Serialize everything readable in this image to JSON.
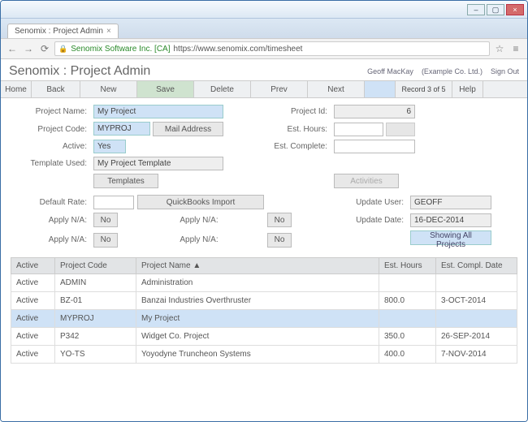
{
  "browser": {
    "tab_title": "Senomix : Project Admin",
    "cert_label": "Senomix Software Inc. [CA]",
    "url": "https://www.senomix.com/timesheet"
  },
  "header": {
    "app_title": "Senomix : Project Admin",
    "user_name": "Geoff MacKay",
    "company": "(Example Co. Ltd.)",
    "signout": "Sign Out"
  },
  "toolbar": {
    "home": "Home",
    "back": "Back",
    "new": "New",
    "save": "Save",
    "delete": "Delete",
    "prev": "Prev",
    "next": "Next",
    "record": "Record 3 of 5",
    "help": "Help"
  },
  "form": {
    "labels": {
      "project_name": "Project Name:",
      "project_code": "Project Code:",
      "active": "Active:",
      "template_used": "Template Used:",
      "project_id": "Project Id:",
      "est_hours": "Est. Hours:",
      "est_complete": "Est. Complete:",
      "default_rate": "Default Rate:",
      "apply_na": "Apply N/A:",
      "update_user": "Update User:",
      "update_date": "Update Date:"
    },
    "values": {
      "project_name": "My Project",
      "project_code": "MYPROJ",
      "active": "Yes",
      "template_used": "My Project Template",
      "project_id": "6",
      "est_hours": "",
      "est_complete": "",
      "default_rate": "",
      "apply_na": "No",
      "update_user": "GEOFF",
      "update_date": "16-DEC-2014"
    },
    "buttons": {
      "mail_address": "Mail Address",
      "templates": "Templates",
      "activities": "Activities",
      "quickbooks": "QuickBooks Import",
      "showing": "Showing All Projects"
    }
  },
  "table": {
    "headers": {
      "active": "Active",
      "code": "Project Code",
      "name": "Project Name ▲",
      "hours": "Est. Hours",
      "date": "Est. Compl. Date"
    },
    "rows": [
      {
        "active": "Active",
        "code": "ADMIN",
        "name": "Administration",
        "hours": "",
        "date": "",
        "sel": false
      },
      {
        "active": "Active",
        "code": "BZ-01",
        "name": "Banzai Industries Overthruster",
        "hours": "800.0",
        "date": "3-OCT-2014",
        "sel": false
      },
      {
        "active": "Active",
        "code": "MYPROJ",
        "name": "My Project",
        "hours": "",
        "date": "",
        "sel": true
      },
      {
        "active": "Active",
        "code": "P342",
        "name": "Widget Co. Project",
        "hours": "350.0",
        "date": "26-SEP-2014",
        "sel": false
      },
      {
        "active": "Active",
        "code": "YO-TS",
        "name": "Yoyodyne Truncheon Systems",
        "hours": "400.0",
        "date": "7-NOV-2014",
        "sel": false
      }
    ]
  }
}
